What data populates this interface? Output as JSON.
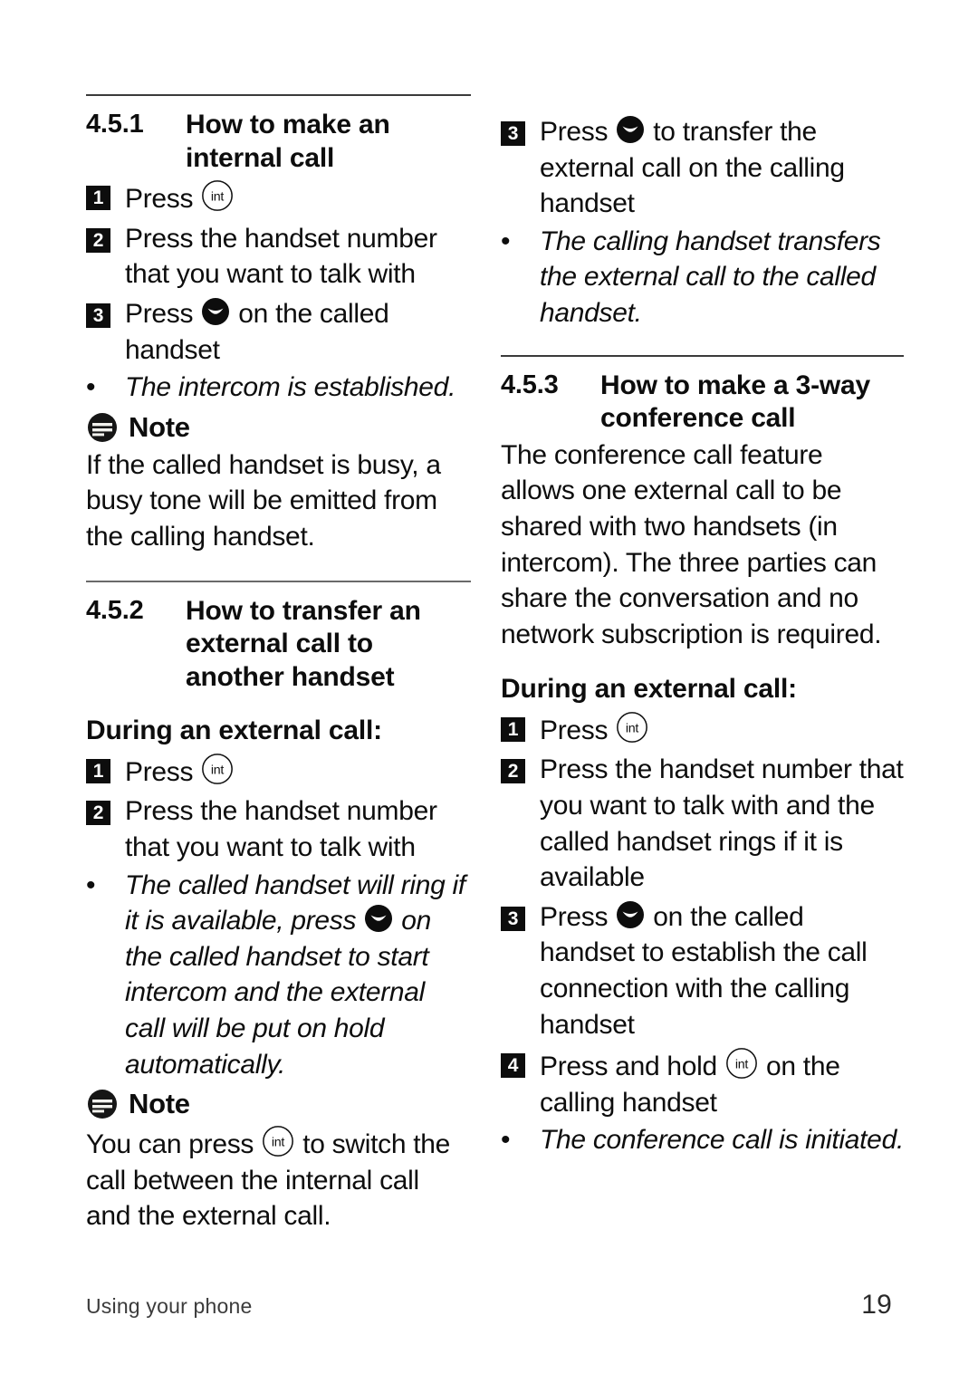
{
  "document": {
    "page_number": "19",
    "footer_left": "Using your phone"
  },
  "icons": {
    "int_key": "int-key-icon",
    "int_label": "int",
    "talk_key": "talk-key-icon",
    "note": "note-icon"
  },
  "left_column": {
    "section_451": {
      "number": "4.5.1",
      "title": "How to make an internal call",
      "steps": [
        {
          "num": "1",
          "before": "Press ",
          "icon": "int",
          "after": ""
        },
        {
          "num": "2",
          "before": "Press the handset number that you want to talk with",
          "icon": "",
          "after": ""
        },
        {
          "num": "3",
          "before": "Press ",
          "icon": "talk",
          "after": " on the called handset"
        }
      ],
      "bullets": [
        {
          "text": "The intercom is established."
        }
      ],
      "note": {
        "label": "Note",
        "body": "If the called handset is busy, a busy tone will be emitted from the calling handset."
      }
    },
    "section_452": {
      "number": "4.5.2",
      "title": "How to transfer an external call to another handset",
      "sub_head": "During an external call:",
      "steps": [
        {
          "num": "1",
          "before": "Press ",
          "icon": "int",
          "after": ""
        },
        {
          "num": "2",
          "before": "Press the handset number that you want to talk with",
          "icon": "",
          "after": ""
        }
      ],
      "bullets": [
        {
          "before": "The called handset will ring if it is available, press ",
          "icon": "talk",
          "after": " on the called handset to start intercom and the external call will be put on hold automatically."
        }
      ],
      "note": {
        "label": "Note",
        "before": "You can press ",
        "icon": "int",
        "after": " to switch the call between the internal call and the external call."
      }
    }
  },
  "right_column": {
    "continued_steps": [
      {
        "num": "3",
        "before": "Press ",
        "icon": "talk",
        "after": " to transfer the external call on the calling handset"
      }
    ],
    "continued_bullets": [
      {
        "text": "The calling handset transfers the external call to the called handset."
      }
    ],
    "section_453": {
      "number": "4.5.3",
      "title": "How to make a 3-way conference call",
      "paragraph": "The conference call feature allows one external call to be shared with two handsets (in intercom). The three parties can share the conversation and no network subscription is required.",
      "sub_head": "During an external call:",
      "steps": [
        {
          "num": "1",
          "before": "Press ",
          "icon": "int",
          "after": ""
        },
        {
          "num": "2",
          "before": "Press the handset number that you want to talk with and the called handset rings if it is available",
          "icon": "",
          "after": ""
        },
        {
          "num": "3",
          "before": "Press ",
          "icon": "talk",
          "after": " on the called handset to establish the call connection with the calling handset"
        },
        {
          "num": "4",
          "before": "Press and hold ",
          "icon": "int",
          "after": " on the calling handset"
        }
      ],
      "bullets": [
        {
          "text": "The conference call is initiated."
        }
      ]
    }
  },
  "colors": {
    "text": "#0d0d0d",
    "rule": "#3b3b3b",
    "marker_bg": "#0d0d0d",
    "marker_fg": "#ffffff"
  }
}
